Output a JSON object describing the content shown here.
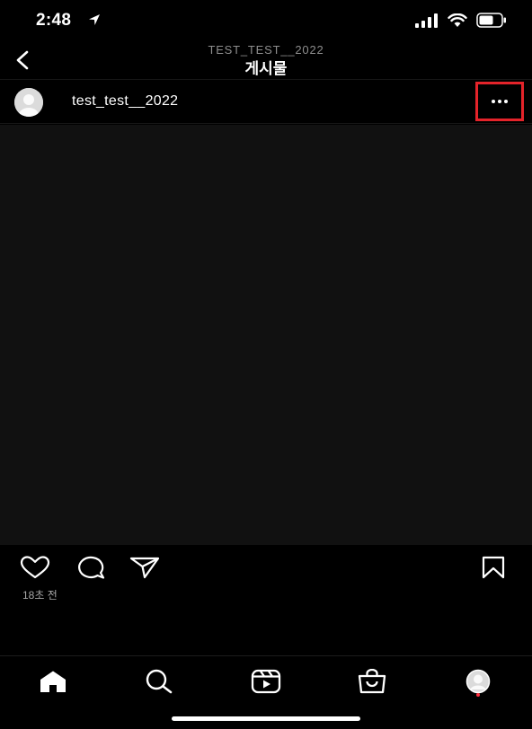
{
  "status": {
    "time": "2:48"
  },
  "header": {
    "subtitle": "TEST_TEST__2022",
    "title": "게시물"
  },
  "post": {
    "username": "test_test__2022",
    "timestamp": "18초 전"
  },
  "colors": {
    "highlight": "#e4232a",
    "background": "#000000",
    "media": "#111111"
  },
  "icons": {
    "status": [
      "location-arrow-icon",
      "signal-icon",
      "wifi-icon",
      "battery-icon"
    ],
    "actions": [
      "heart-icon",
      "comment-icon",
      "share-icon",
      "bookmark-icon"
    ],
    "tabs": [
      "home-icon",
      "search-icon",
      "reels-icon",
      "shop-icon",
      "profile-icon"
    ]
  }
}
